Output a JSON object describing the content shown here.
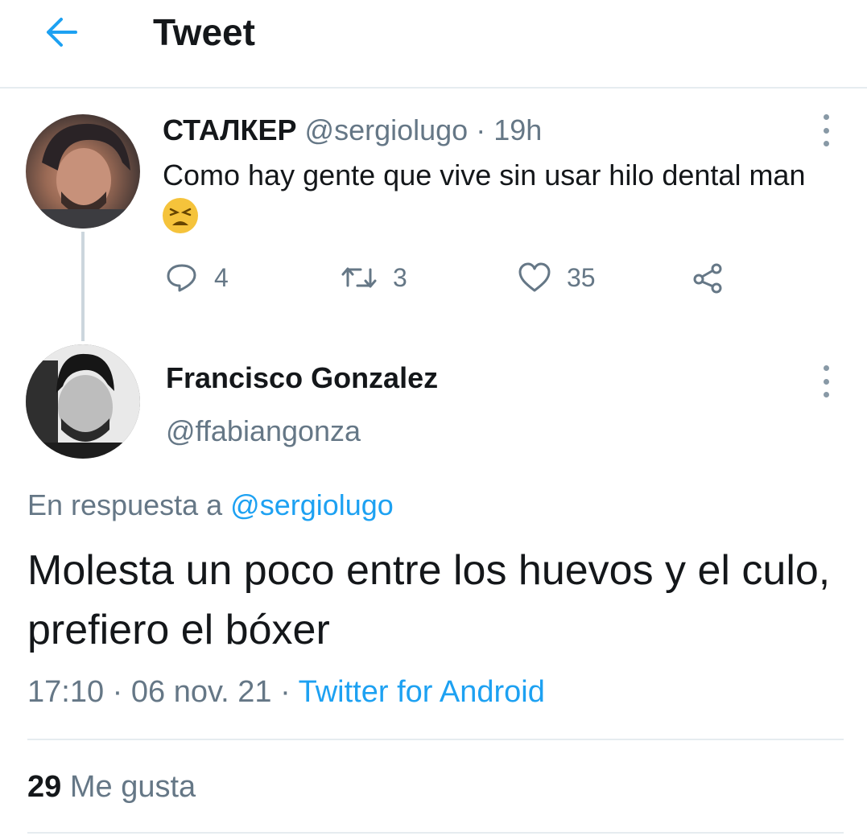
{
  "header": {
    "title": "Tweet",
    "back_icon": "arrow-left-icon",
    "accent_color": "#1da1f2"
  },
  "parent_tweet": {
    "display_name": "СТАЛКЕР",
    "handle": "@sergiolugo",
    "separator": "·",
    "time": "19h",
    "text": "Como hay gente que vive sin usar hilo dental man",
    "emoji": "tired-face-emoji",
    "actions": {
      "reply_count": "4",
      "retweet_count": "3",
      "like_count": "35"
    }
  },
  "main_tweet": {
    "display_name": "Francisco Gonzalez",
    "handle": "@ffabiangonza",
    "reply_prefix": "En respuesta a",
    "reply_to": "@sergiolugo",
    "text": "Molesta un poco entre los huevos y el culo, prefiero el bóxer",
    "time": "17:10",
    "separator": "·",
    "date": "06 nov. 21",
    "source": "Twitter for Android",
    "likes_count": "29",
    "likes_label": "Me gusta"
  }
}
